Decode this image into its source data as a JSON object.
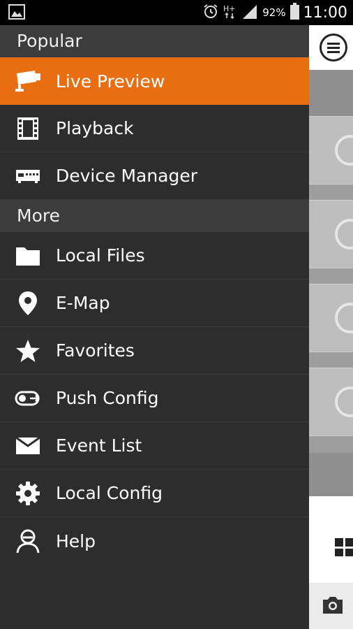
{
  "status_bar": {
    "battery_percent": "92%",
    "time": "11:00"
  },
  "drawer": {
    "sections": [
      {
        "title": "Popular",
        "items": [
          {
            "label": "Live Preview",
            "icon": "cctv-camera-icon",
            "active": true
          },
          {
            "label": "Playback",
            "icon": "film-strip-icon"
          },
          {
            "label": "Device Manager",
            "icon": "dvr-device-icon"
          }
        ]
      },
      {
        "title": "More",
        "items": [
          {
            "label": "Local Files",
            "icon": "folder-icon"
          },
          {
            "label": "E-Map",
            "icon": "map-pin-icon"
          },
          {
            "label": "Favorites",
            "icon": "star-icon"
          },
          {
            "label": "Push Config",
            "icon": "toggle-push-icon"
          },
          {
            "label": "Event List",
            "icon": "envelope-icon"
          },
          {
            "label": "Local Config",
            "icon": "gear-icon"
          },
          {
            "label": "Help",
            "icon": "user-help-icon"
          }
        ]
      }
    ]
  },
  "colors": {
    "accent": "#e96e12",
    "drawer_bg": "#2d2d2d",
    "section_bg": "#3c3c3c"
  }
}
